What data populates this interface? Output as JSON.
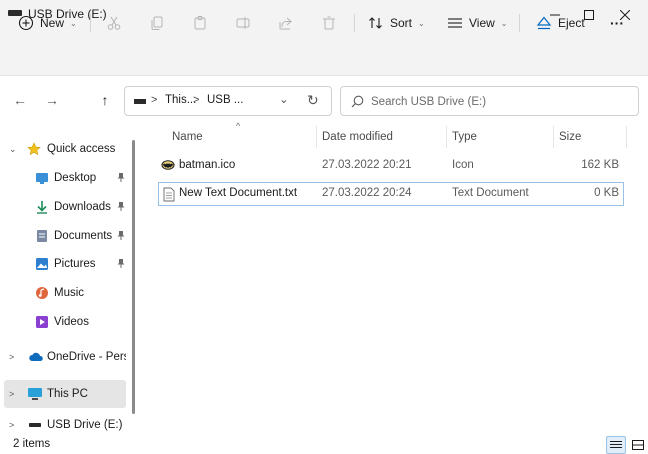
{
  "window": {
    "title": "USB Drive (E:)",
    "minimize_glyph": "—",
    "maximize_glyph": "☐",
    "close_glyph": "✕"
  },
  "toolbar": {
    "new_label": "New",
    "sort_label": "Sort",
    "view_label": "View",
    "eject_label": "Eject",
    "more_glyph": "···",
    "chevron_glyph": "⌄",
    "disabled_actions": [
      "cut-icon",
      "copy-icon",
      "paste-icon",
      "rename-icon",
      "share-icon",
      "delete-icon"
    ]
  },
  "nav": {
    "back_glyph": "←",
    "forward_glyph": "→",
    "up_glyph": "↑",
    "refresh_glyph": "↻",
    "address": {
      "segments": [
        "This...",
        "USB ..."
      ],
      "separator": ">",
      "dropdown_glyph": "⌄"
    },
    "search": {
      "placeholder": "Search USB Drive (E:)"
    }
  },
  "sidebar": {
    "pin_glyph": "📌",
    "expand_glyph": ">",
    "collapse_glyph": "⌄",
    "quick_access": "Quick access",
    "items": [
      {
        "label": "Desktop",
        "icon": "desktop-icon",
        "color": "#3a8fd9"
      },
      {
        "label": "Downloads",
        "icon": "download-icon",
        "color": "#1e8c5a"
      },
      {
        "label": "Documents",
        "icon": "documents-icon",
        "color": "#7a8aa3"
      },
      {
        "label": "Pictures",
        "icon": "pictures-icon",
        "color": "#2f7fd1"
      },
      {
        "label": "Music",
        "icon": "music-icon",
        "color": "#e0673d"
      },
      {
        "label": "Videos",
        "icon": "videos-icon",
        "color": "#8a3fd1"
      }
    ],
    "onedrive": "OneDrive - Perso",
    "this_pc": "This PC",
    "usb": "USB Drive (E:)"
  },
  "content": {
    "sort_indicator": "^",
    "columns": {
      "name": "Name",
      "date": "Date modified",
      "type": "Type",
      "size": "Size"
    },
    "files": [
      {
        "name": "batman.ico",
        "date": "27.03.2022 20:21",
        "type": "Icon",
        "size": "162 KB",
        "icon": "batman-icon"
      },
      {
        "name": "New Text Document.txt",
        "date": "27.03.2022 20:24",
        "type": "Text Document",
        "size": "0 KB",
        "icon": "text-file-icon"
      }
    ]
  },
  "status": {
    "count": "2 items"
  },
  "colors": {
    "accent": "#0067c0",
    "chrome": "#f3f3f3",
    "selection_border": "#99c2e6"
  }
}
